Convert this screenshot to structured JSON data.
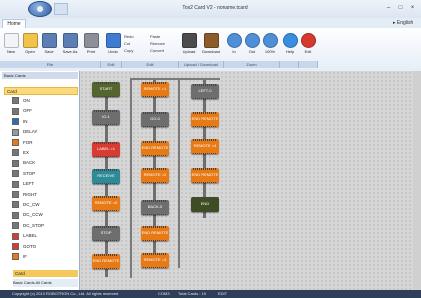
{
  "window": {
    "title": "Tox2 Card V2 - noname.tcard",
    "min": "–",
    "max": "□",
    "close": "×"
  },
  "ribbon": {
    "active_tab": "Home",
    "language": "▸ English"
  },
  "toolbar": {
    "buttons": [
      {
        "label": "New",
        "color": "#f2f4f7"
      },
      {
        "label": "Open",
        "color": "#f2c34a"
      },
      {
        "label": "Save",
        "color": "#5b7fb4"
      },
      {
        "label": "Save As",
        "color": "#5b7fb4"
      },
      {
        "label": "Print",
        "color": "#8a8f99"
      },
      {
        "label": "Undo",
        "color": "#3f7bd1"
      }
    ],
    "edit_items": [
      "Redo",
      "Cut",
      "Copy",
      "Paste",
      "Remove",
      "Convert"
    ],
    "right_buttons": [
      {
        "label": "Upload",
        "color": "#4c4c4c"
      },
      {
        "label": "Download",
        "color": "#8b5b2c"
      },
      {
        "label": "In",
        "color": "#4f8fd8"
      },
      {
        "label": "Out",
        "color": "#4f8fd8"
      },
      {
        "label": "100%",
        "color": "#4f8fd8"
      },
      {
        "label": "Help",
        "color": "#3a8ee0"
      },
      {
        "label": "Exit",
        "color": "#d63a2f"
      }
    ],
    "groups": [
      "File",
      "Edit",
      "Edit",
      "Upload / Download",
      "Zoom",
      "",
      ""
    ]
  },
  "sidebar": {
    "header": "Basic Cards",
    "group_title": "Card",
    "items": [
      {
        "label": "ON",
        "color": "#777"
      },
      {
        "label": "OFF",
        "color": "#777"
      },
      {
        "label": "IN",
        "color": "#2e6db5"
      },
      {
        "label": "DELAY",
        "color": "#999"
      },
      {
        "label": "FOR",
        "color": "#e87a16"
      },
      {
        "label": "EX",
        "color": "#777"
      },
      {
        "label": "BACK",
        "color": "#777"
      },
      {
        "label": "STOP",
        "color": "#777"
      },
      {
        "label": "LEFT",
        "color": "#777"
      },
      {
        "label": "RIGHT",
        "color": "#777"
      },
      {
        "label": "DC_CW",
        "color": "#777"
      },
      {
        "label": "DC_CCW",
        "color": "#777"
      },
      {
        "label": "DC_STOP",
        "color": "#777"
      },
      {
        "label": "LABEL",
        "color": "#d73b31"
      },
      {
        "label": "GOTO",
        "color": "#d73b31"
      },
      {
        "label": "IF",
        "color": "#e87a16"
      }
    ],
    "footer_group": "Card",
    "tabs": "Basic Cards  All Cards"
  },
  "canvas": {
    "col1": [
      "START",
      "IO-1",
      "LABEL =1",
      "RECEIVE",
      "REMOTE =0",
      "STOP",
      "END REMOTE"
    ],
    "col2": [
      "REMOTE =1",
      "GO-0",
      "END REMOTE",
      "REMOTE =2",
      "BACK-0",
      "END REMOTE",
      "REMOTE =3"
    ],
    "col3": [
      "LEFT-0",
      "END REMOTE",
      "REMOTE =4",
      "END REMOTE",
      "END"
    ]
  },
  "status": {
    "copyright": "Copyright (c) 2013 ROBOTRON Co., Ltd. All rights reserved.",
    "port": "COM3",
    "total": "Total Cards : 19",
    "mode": "EDIT"
  }
}
